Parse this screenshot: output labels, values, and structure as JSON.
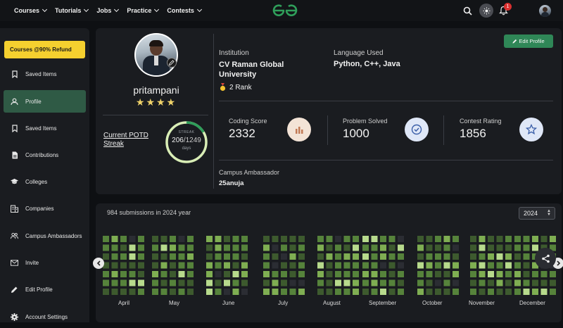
{
  "nav": {
    "items": [
      {
        "label": "Courses"
      },
      {
        "label": "Tutorials"
      },
      {
        "label": "Jobs"
      },
      {
        "label": "Practice"
      },
      {
        "label": "Contests"
      }
    ],
    "notification_count": "1"
  },
  "sidebar": {
    "refund_label": "Courses @90% Refund",
    "items": [
      {
        "label": "Saved Items",
        "icon": "bookmark-icon"
      },
      {
        "label": "Profile",
        "icon": "user-icon"
      },
      {
        "label": "Saved Items",
        "icon": "bookmark-icon"
      },
      {
        "label": "Contributions",
        "icon": "document-icon"
      },
      {
        "label": "Colleges",
        "icon": "graduation-cap-icon"
      },
      {
        "label": "Companies",
        "icon": "building-icon"
      },
      {
        "label": "Campus Ambassadors",
        "icon": "users-icon"
      },
      {
        "label": "Invite",
        "icon": "mail-icon"
      },
      {
        "label": "Edit Profile",
        "icon": "pencil-icon"
      },
      {
        "label": "Account Settings",
        "icon": "gear-icon"
      }
    ]
  },
  "profile": {
    "username": "pritampani",
    "stars": "★★★★",
    "edit_label": "Edit Profile",
    "potd_label": "Current POTD Streak",
    "streak_title": "STREAK",
    "streak_value": "206",
    "streak_total": "/1249",
    "streak_unit": "days",
    "streak_fraction": 0.165,
    "institution_label": "Institution",
    "institution_value": "CV Raman Global University",
    "rank_value": "2 Rank",
    "language_label": "Language Used",
    "language_value": "Python, C++, Java",
    "coding_score_label": "Coding Score",
    "coding_score_value": "2332",
    "problems_label": "Problem Solved",
    "problems_value": "1000",
    "contest_label": "Contest Rating",
    "contest_value": "1856",
    "ambassador_label": "Campus Ambassador",
    "ambassador_value": "25anuja"
  },
  "heatmap": {
    "title": "984 submissions in 2024 year",
    "year_selected": "2024",
    "months": [
      "April",
      "May",
      "June",
      "July",
      "August",
      "September",
      "October",
      "November",
      "December"
    ],
    "colors": {
      "empty": "#2b2d33",
      "l1": "#3d5a2e",
      "l2": "#56833b",
      "l3": "#7fae52",
      "l4": "#b7da8c"
    }
  }
}
